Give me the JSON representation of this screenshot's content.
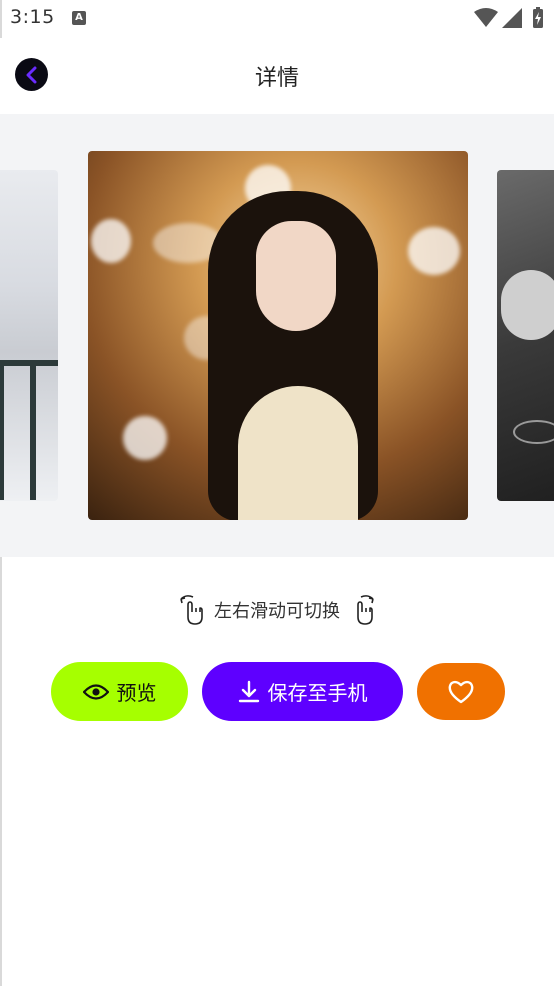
{
  "status_bar": {
    "time": "3:15"
  },
  "header": {
    "title": "详情"
  },
  "carousel": {
    "slides": [
      {
        "name": "snowy-balcony-photo"
      },
      {
        "name": "girl-portrait-photo"
      },
      {
        "name": "hand-wineglass-photo"
      }
    ]
  },
  "hint": {
    "text": "左右滑动可切换"
  },
  "actions": {
    "preview_label": "预览",
    "save_label": "保存至手机"
  },
  "colors": {
    "preview": "#a6ff00",
    "save": "#5e00ff",
    "favorite": "#f07100",
    "back_button": "#0a0a14",
    "back_chevron": "#6a2cff"
  },
  "icons": [
    "eye-icon",
    "download-icon",
    "heart-icon",
    "chevron-left-icon",
    "swipe-hand-icon"
  ]
}
